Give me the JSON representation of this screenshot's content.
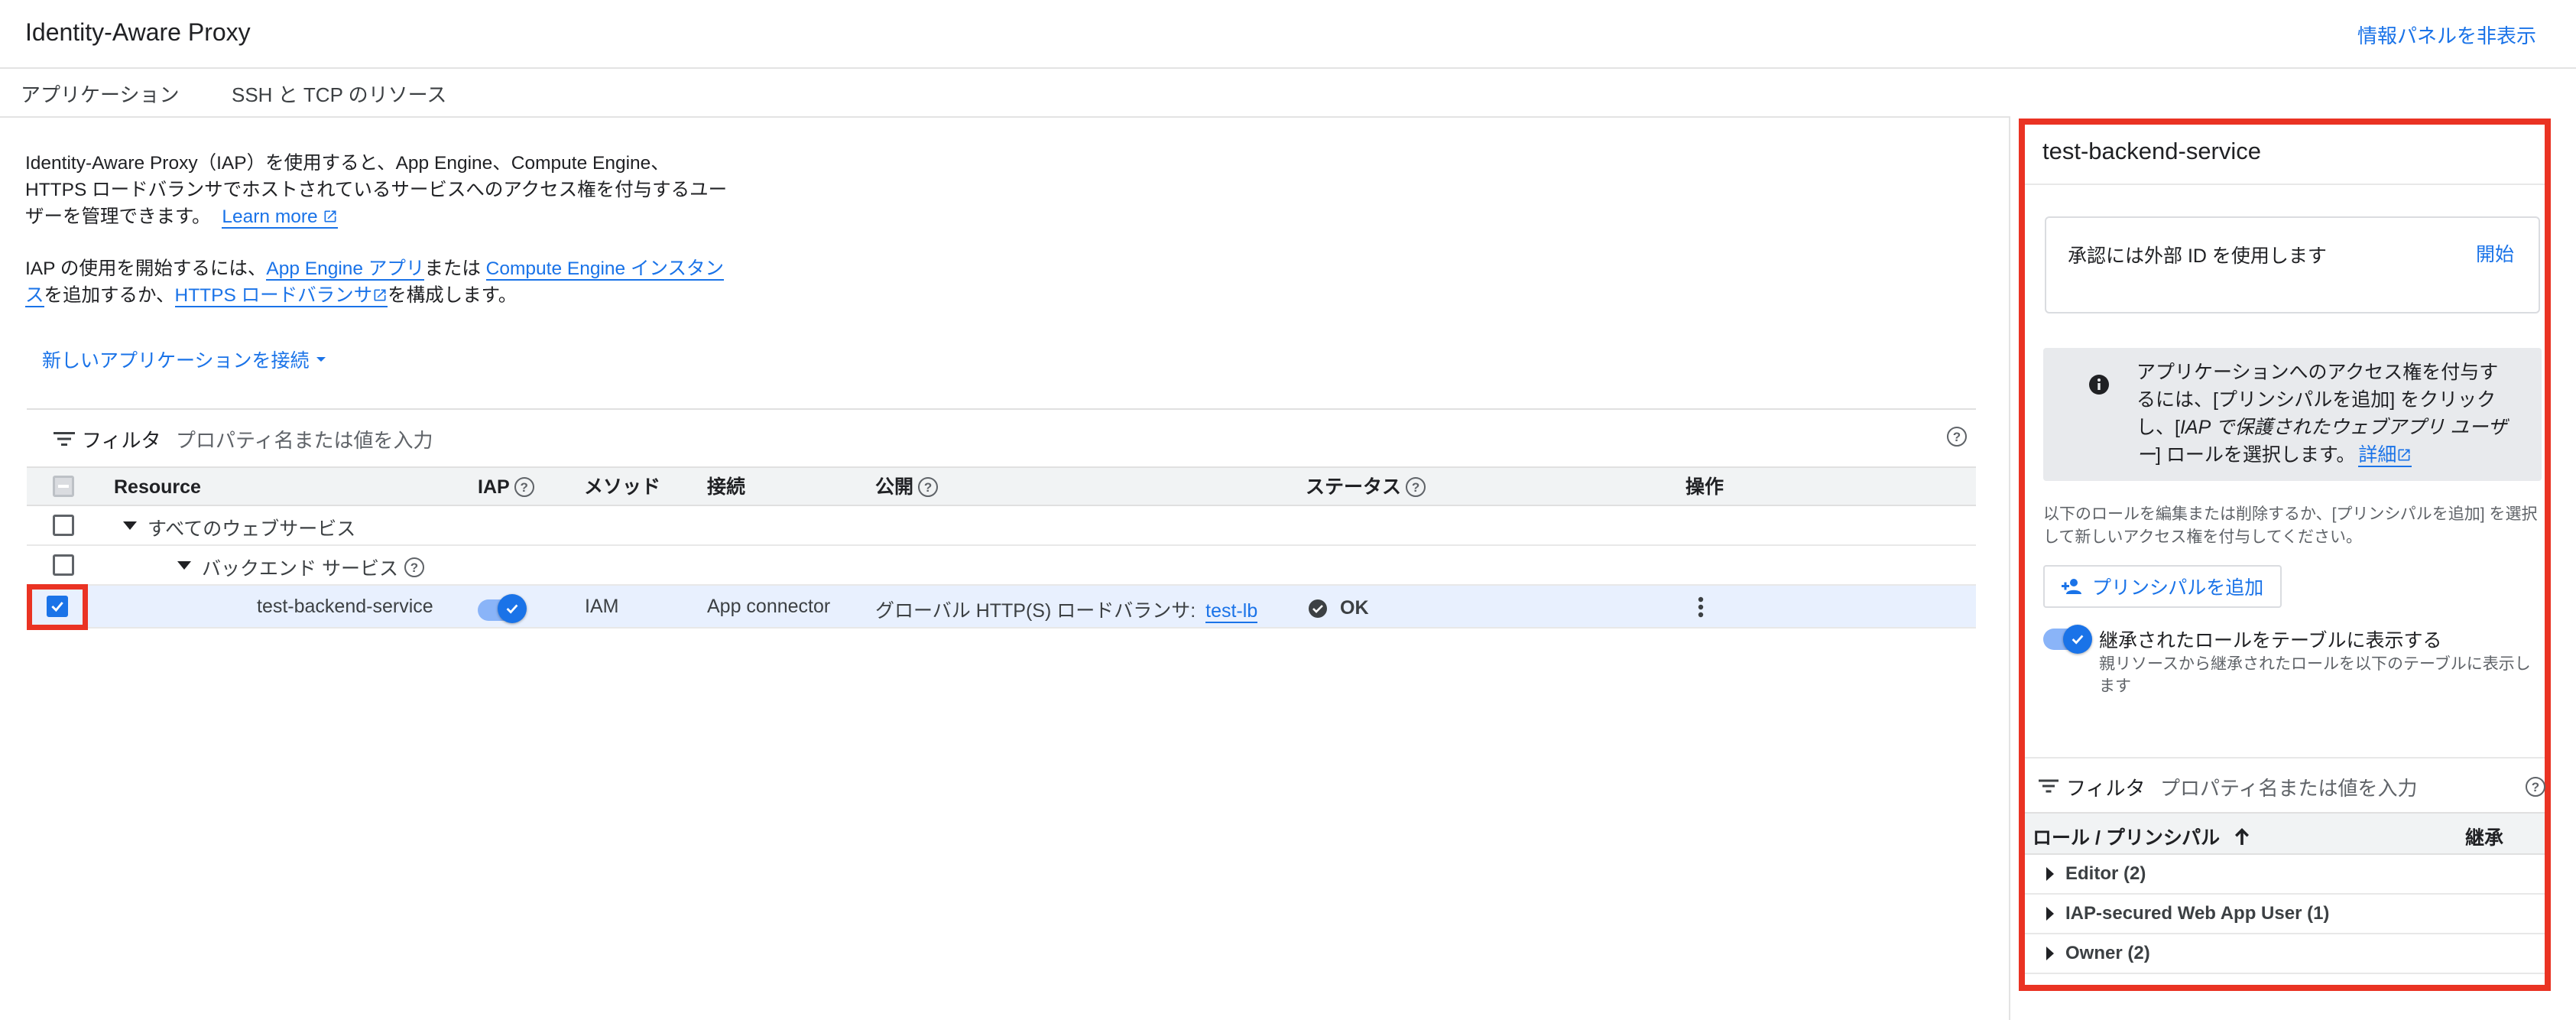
{
  "header": {
    "title": "Identity-Aware Proxy",
    "toggle_info_panel": "情報パネルを非表示"
  },
  "tabs": [
    "アプリケーション",
    "SSH と TCP のリソース"
  ],
  "intro": {
    "p1_text": "Identity-Aware Proxy（IAP）を使用すると、App Engine、Compute Engine、HTTPS ロードバランサでホストされているサービスへのアクセス権を付与するユーザーを管理できます。",
    "learn_more": "Learn more",
    "p2_prefix": "IAP の使用を開始するには、",
    "link_app_engine": "App Engine アプリ",
    "p2_mid1": "または ",
    "link_compute_engine": "Compute Engine インスタンス",
    "p2_mid2": "を追加するか、",
    "link_https_lb": "HTTPS ロードバランサ",
    "p2_suffix": "を構成します。",
    "connect_new_app": "新しいアプリケーションを接続"
  },
  "main_table": {
    "filter_label": "フィルタ",
    "filter_placeholder": "プロパティ名または値を入力",
    "columns": {
      "resource": "Resource",
      "iap": "IAP",
      "method": "メソッド",
      "connection": "接続",
      "publish": "公開",
      "status": "ステータス",
      "actions": "操作"
    },
    "rows": {
      "all_web_services": "すべてのウェブサービス",
      "backend_services": "バックエンド サービス",
      "service": {
        "name": "test-backend-service",
        "iap_enabled": true,
        "method": "IAM",
        "connection": "App connector",
        "publish_prefix": "グローバル HTTP(S) ロードバランサ:",
        "publish_link": "test-lb",
        "status": "OK",
        "checked": true
      }
    }
  },
  "side_panel": {
    "title": "test-backend-service",
    "external_id_text": "承認には外部 ID を使用します",
    "external_id_action": "開始",
    "info_line1": "アプリケーションへのアクセス権を付与す",
    "info_line2": "るには、[プリンシパルを追加] をクリック",
    "info_line3_a": "し、[",
    "info_line3_italic": "IAP で保護されたウェブアプリ ユーザ",
    "info_line4_italic": "ー",
    "info_line4_b": "] ロールを選択します。",
    "info_link": "詳細",
    "edit_roles_text": "以下のロールを編集または削除するか、[プリンシパルを追加] を選択して新しいアクセス権を付与してください。",
    "add_principal": "プリンシパルを追加",
    "inherited_toggle_label": "継承されたロールをテーブルに表示する",
    "inherited_toggle_desc": "親リソースから継承されたロールを以下のテーブルに表示します",
    "inherited_on": true,
    "filter_label": "フィルタ",
    "filter_placeholder": "プロパティ名または値を入力",
    "col_role_principal": "ロール / プリンシパル",
    "col_inherit": "継承",
    "roles": [
      "Editor (2)",
      "IAP-secured Web App User (1)",
      "Owner (2)"
    ]
  },
  "icons": {
    "external_link": "external-link-icon",
    "filter": "filter-icon",
    "help": "help-icon",
    "info": "info-icon",
    "more": "more-vert-icon",
    "status_ok": "check-circle-icon",
    "add_person": "person-add-icon",
    "sort_up": "arrow-up-icon",
    "expand": "triangle-right-icon"
  },
  "colors": {
    "accent": "#1a73e8",
    "highlight": "#ea3323",
    "status_ok": "#3c4043"
  }
}
